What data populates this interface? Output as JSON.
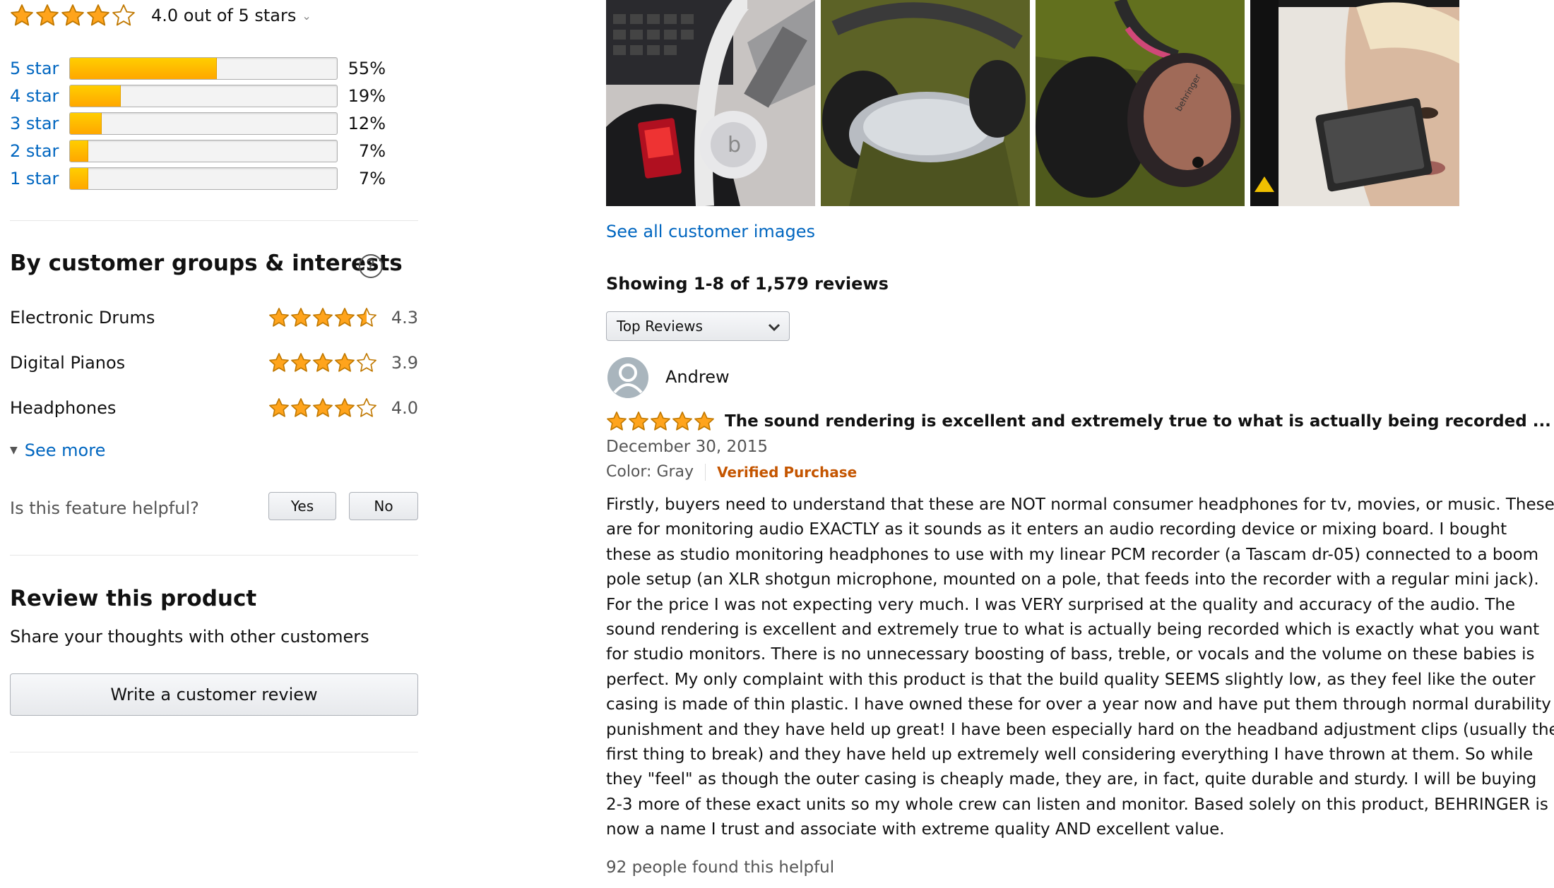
{
  "summary": {
    "rating_text": "4.0 out of 5 stars",
    "rating": 4.0
  },
  "histogram": [
    {
      "label": "5 star",
      "pct_text": "55%",
      "pct": 55
    },
    {
      "label": "4 star",
      "pct_text": "19%",
      "pct": 19
    },
    {
      "label": "3 star",
      "pct_text": "12%",
      "pct": 12
    },
    {
      "label": "2 star",
      "pct_text": "7%",
      "pct": 7
    },
    {
      "label": "1 star",
      "pct_text": "7%",
      "pct": 7
    }
  ],
  "groups": {
    "title": "By customer groups & interests",
    "help_glyph": "?",
    "items": [
      {
        "name": "Electronic Drums",
        "rating_text": "4.3",
        "rating": 4.3
      },
      {
        "name": "Digital Pianos",
        "rating_text": "3.9",
        "rating": 3.9
      },
      {
        "name": "Headphones",
        "rating_text": "4.0",
        "rating": 4.0
      }
    ],
    "see_more": "See more",
    "helpful_question": "Is this feature helpful?",
    "yes": "Yes",
    "no": "No"
  },
  "review_product": {
    "title": "Review this product",
    "subtitle": "Share your thoughts with other customers",
    "button": "Write a customer review"
  },
  "images": {
    "see_all": "See all customer images"
  },
  "reviews": {
    "showing": "Showing 1-8 of 1,579 reviews",
    "sort_selected": "Top Reviews",
    "first": {
      "author": "Andrew",
      "rating": 5,
      "title": "The sound rendering is excellent and extremely true to what is actually being recorded ...",
      "date": "December 30, 2015",
      "color": "Color: Gray",
      "verified": "Verified Purchase",
      "body": [
        "Firstly, buyers need to understand that these are NOT normal consumer headphones for tv, movies, or music. These",
        "are for monitoring audio EXACTLY as it sounds as it enters an audio recording device or mixing board. I bought",
        "these as studio monitoring headphones to use with my linear PCM recorder (a Tascam dr-05) connected to a boom",
        "pole setup (an XLR shotgun microphone, mounted on a pole, that feeds into the recorder with a regular mini jack).",
        "For the price I was not expecting very much. I was VERY surprised at the quality and accuracy of the audio. The",
        "sound rendering is excellent and extremely true to what is actually being recorded which is exactly what you want",
        "for studio monitors. There is no unnecessary boosting of bass, treble, or vocals and the volume on these babies is",
        "perfect. My only complaint with this product is that the build quality SEEMS slightly low, as they feel like the outer",
        "casing is made of thin plastic. I have owned these for over a year now and have put them through normal durability",
        "punishment and they have held up great! I have been especially hard on the headband adjustment clips (usually the",
        "first thing to break) and they have held up extremely well considering everything I have thrown at them. So while",
        "they \"feel\" as though the outer casing is cheaply made, they are, in fact, quite durable and sturdy. I will be buying",
        "2-3 more of these exact units so my whole crew can listen and monitor. Based solely on this product, BEHRINGER is",
        "now a name I trust and associate with extreme quality AND excellent value."
      ],
      "helpful": "92 people found this helpful"
    }
  },
  "colors": {
    "link": "#0066c0",
    "star": "#ffa41c",
    "bar_fill": "#ffa700",
    "verified": "#c45500"
  }
}
